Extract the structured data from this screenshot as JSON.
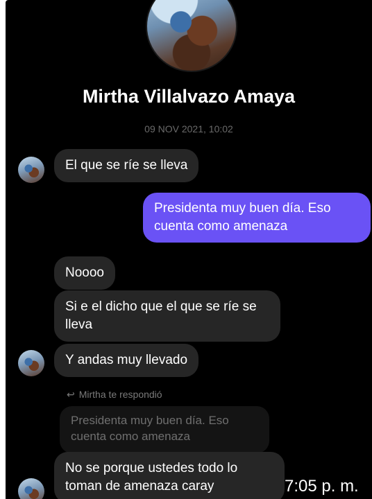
{
  "contact": {
    "name": "Mirtha Villalvazo Amaya"
  },
  "thread": {
    "timestamp": "09 NOV 2021, 10:02"
  },
  "messages": [
    {
      "direction": "incoming",
      "text": "El que se ríe se lleva"
    },
    {
      "direction": "outgoing",
      "text": "Presidenta muy buen día. Eso cuenta como amenaza"
    },
    {
      "direction": "incoming",
      "text": "Noooo"
    },
    {
      "direction": "incoming",
      "text": "Si e el dicho que el que se ríe se lleva"
    },
    {
      "direction": "incoming",
      "text": "Y andas muy llevado"
    },
    {
      "direction": "incoming",
      "text": "No se porque ustedes todo lo toman de amenaza caray"
    }
  ],
  "reply": {
    "label": "Mirtha te respondió",
    "quoted_text": "Presidenta muy buen día. Eso cuenta como amenaza"
  },
  "overlay": {
    "time": "7:05 p. m."
  },
  "colors": {
    "background": "#000000",
    "incoming_bubble": "#262626",
    "outgoing_bubble": "#6a52f5"
  },
  "icons": {
    "reply": "reply-arrow-icon"
  }
}
